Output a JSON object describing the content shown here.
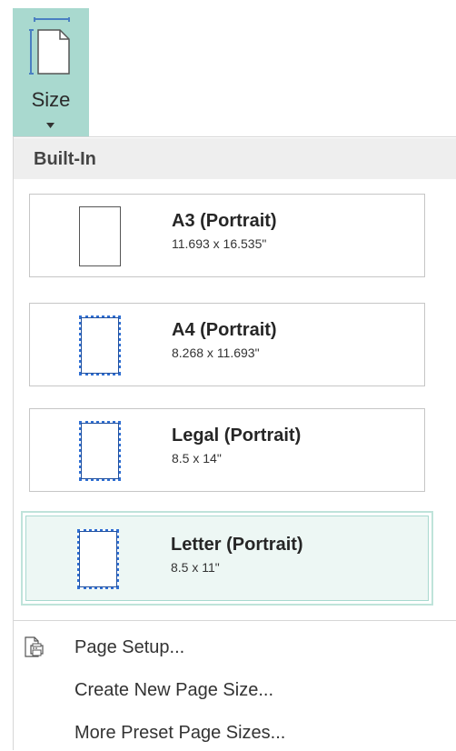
{
  "ribbon": {
    "size_button": {
      "label": "Size",
      "icon": "page-size-icon",
      "accent": "#a9d9cf"
    }
  },
  "menu": {
    "section_header": "Built-In",
    "options": [
      {
        "name": "A3 (Portrait)",
        "dimensions": "11.693 x 16.535\"",
        "icon": "plain-page-icon",
        "selected": false
      },
      {
        "name": "A4 (Portrait)",
        "dimensions": "8.268 x 11.693\"",
        "icon": "dotted-page-icon",
        "selected": false
      },
      {
        "name": "Legal (Portrait)",
        "dimensions": "8.5 x 14\"",
        "icon": "dotted-page-icon",
        "selected": false
      },
      {
        "name": "Letter (Portrait)",
        "dimensions": "8.5 x 11\"",
        "icon": "dotted-page-icon",
        "selected": true
      }
    ],
    "commands": [
      {
        "label": "Page Setup...",
        "icon": "page-setup-icon"
      },
      {
        "label": "Create New Page Size...",
        "icon": ""
      },
      {
        "label": "More Preset Page Sizes...",
        "icon": ""
      }
    ]
  }
}
